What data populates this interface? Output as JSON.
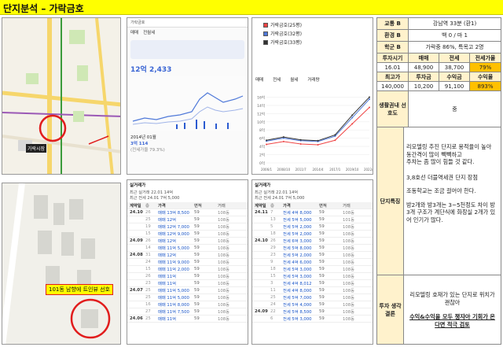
{
  "header": {
    "title": "단지분석 – 가락금호"
  },
  "map1": {
    "labels": [
      "가락시장"
    ],
    "colors": {
      "road_yellow": "#f6d66b",
      "rail_green": "#3b9b3b",
      "rail_purple": "#9b59b6",
      "marker_red": "#e11d1d"
    }
  },
  "map2": {
    "callout": "101동 남향에 트인뷰 선호",
    "colors": {
      "callout_bg": "#ffff00",
      "marker_red": "#e11d1d"
    }
  },
  "phone1": {
    "app_title": "가락금호",
    "tabs": [
      "매매",
      "전월세"
    ],
    "price_label": "12억 2,433",
    "sub_label": "2014년 01월",
    "sub_value": "3억 114",
    "sub_note": "(전세가율 79.3%)"
  },
  "phone2": {
    "legend": [
      "가락금호(25평)",
      "가락금호(32평)",
      "가락금호(33평)"
    ],
    "legend_colors": [
      "#ef4444",
      "#4f79d9",
      "#333333"
    ],
    "filters": [
      "매매",
      "전세",
      "월세",
      "거래량"
    ],
    "chart_data": {
      "type": "line",
      "x": [
        "2006/1",
        "2008/10",
        "2011/7",
        "2014/4",
        "2017/1",
        "2019/10",
        "2022/7"
      ],
      "ylim": [
        0,
        18
      ],
      "yticks": [
        "0억",
        "2억",
        "4억",
        "6억",
        "8억",
        "10억",
        "12억",
        "14억",
        "16억"
      ],
      "series": [
        {
          "name": "가락금호(25평)",
          "values": [
            4.5,
            5.2,
            4.6,
            4.4,
            5.5,
            9.5,
            13.5
          ]
        },
        {
          "name": "가락금호(32평)",
          "values": [
            5.3,
            6.0,
            5.4,
            5.2,
            6.5,
            11.0,
            15.5
          ]
        },
        {
          "name": "가락금호(33평)",
          "values": [
            5.5,
            6.3,
            5.6,
            5.4,
            6.8,
            11.6,
            16.0
          ]
        }
      ]
    }
  },
  "phone3": {
    "section": "실거래가",
    "summary1": "최근 실거래 22.01 14억",
    "summary2": "최근 전세 24.01 7억 5,000",
    "columns": [
      "계약일",
      "층",
      "가격",
      "면적",
      "거래"
    ],
    "rows": [
      [
        "24.10",
        "26",
        "매매 13억 8,500",
        "59",
        "108동"
      ],
      [
        "",
        "25",
        "매매 12억",
        "59",
        "108동"
      ],
      [
        "",
        "19",
        "매매 12억 7,000",
        "59",
        "108동"
      ],
      [
        "",
        "15",
        "매매 12억 9,000",
        "59",
        "108동"
      ],
      [
        "24.09",
        "26",
        "매매 12억",
        "59",
        "108동"
      ],
      [
        "",
        "14",
        "매매 11억 5,000",
        "59",
        "108동"
      ],
      [
        "24.08",
        "31",
        "매매 12억",
        "59",
        "108동"
      ],
      [
        "",
        "24",
        "매매 11억 9,000",
        "59",
        "108동"
      ],
      [
        "",
        "15",
        "매매 11억 2,000",
        "59",
        "108동"
      ],
      [
        "",
        "26",
        "매매 11억",
        "59",
        "108동"
      ],
      [
        "",
        "23",
        "매매 11억",
        "59",
        "108동"
      ],
      [
        "24.07",
        "25",
        "매매 11억 5,000",
        "59",
        "108동"
      ],
      [
        "",
        "25",
        "매매 11억 5,000",
        "59",
        "108동"
      ],
      [
        "",
        "16",
        "매매 11억 8,000",
        "59",
        "108동"
      ],
      [
        "",
        "27",
        "매매 11억 7,500",
        "59",
        "108동"
      ],
      [
        "24.06",
        "25",
        "매매 11억",
        "59",
        "108동"
      ]
    ]
  },
  "phone4": {
    "section": "실거래가",
    "summary1": "최근 실거래 22.01 14억",
    "summary2": "최근 전세 24.01 7억 5,000",
    "columns": [
      "계약일",
      "층",
      "가격",
      "면적",
      "거래"
    ],
    "rows": [
      [
        "24.11",
        "7",
        "전세 4억 8,000",
        "59",
        "108동"
      ],
      [
        "",
        "13",
        "전세 5억 5,000",
        "59",
        "101동"
      ],
      [
        "",
        "5",
        "전세 5억 2,000",
        "59",
        "108동"
      ],
      [
        "",
        "18",
        "전세 5억 2,000",
        "59",
        "108동"
      ],
      [
        "24.10",
        "26",
        "전세 6억 3,000",
        "59",
        "108동"
      ],
      [
        "",
        "29",
        "전세 5억 8,000",
        "59",
        "108동"
      ],
      [
        "",
        "23",
        "전세 5억 2,000",
        "59",
        "108동"
      ],
      [
        "",
        "9",
        "전세 4억 6,000",
        "59",
        "108동"
      ],
      [
        "",
        "18",
        "전세 5억 3,000",
        "59",
        "108동"
      ],
      [
        "",
        "15",
        "전세 5억 3,000",
        "59",
        "108동"
      ],
      [
        "",
        "3",
        "전세 4억 8,012",
        "59",
        "108동"
      ],
      [
        "",
        "11",
        "전세 4억 8,000",
        "59",
        "108동"
      ],
      [
        "",
        "25",
        "전세 5억 7,000",
        "59",
        "108동"
      ],
      [
        "",
        "24",
        "전세 5억 4,000",
        "59",
        "108동"
      ],
      [
        "24.09",
        "22",
        "전세 5억 8,500",
        "59",
        "108동"
      ],
      [
        "",
        "6",
        "전세 5억 3,000",
        "59",
        "108동"
      ]
    ]
  },
  "info": {
    "traffic_label": "교통 B",
    "traffic_value": "강남역 33분 (환1)",
    "env_label": "환경 B",
    "env_value": "백 0 / 마 1",
    "school_label": "학군 B",
    "school_value": "가락중 86%, 특목고 2명",
    "invest_time_label": "투자시기",
    "sale_label": "매매",
    "jeonse_label": "전세",
    "ratio_label": "전세가율",
    "invest_time": "16.01",
    "sale": "48,900",
    "jeonse": "38,700",
    "ratio": "79%",
    "high_label": "최고가",
    "invest_amt_label": "투자금",
    "profit_label": "수익금",
    "roi_label": "수익율",
    "high": "140,000",
    "invest_amt": "10,200",
    "profit": "91,100",
    "roi": "893%",
    "living_label": "생활권내 선호도",
    "living_value": "중",
    "features_label": "단지특징",
    "features": [
      "리모델링 추진 단지로 용적율이 높아",
      "동간격이 많이 빽빽하고",
      "주차는 좀 많이 힘들 것 같다.",
      "3,8호선 더블역세권 단지 장점",
      "조동학교는 조금 걸어야 한다.",
      "방2개와 방3개는 3~5천정도 차이 방3개 구조가 계단식에 화장실 2개가 있어 인기가 많다."
    ],
    "conclusion_label": "투자 생각 결론",
    "conclusion1": "리모델링 호재가 있는 단지로 위치가 괜찮아",
    "conclusion2": "수익&수익을 모두 챙쟈아 기회가 온다면 적극 검토"
  }
}
